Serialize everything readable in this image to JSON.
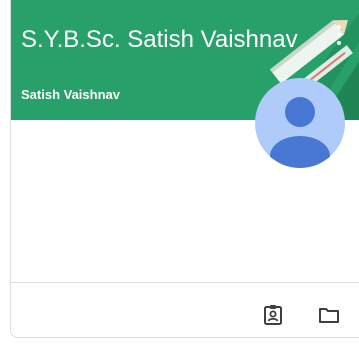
{
  "course_card": {
    "title": "S.Y.B.Sc. Satish Vaishnav",
    "teacher": "Satish Vaishnav",
    "banner_color": "#28a06a",
    "avatar_color": "#aecbfa",
    "avatar_figure_color": "#4778d4",
    "icons": {
      "menu": "more-vert-icon",
      "avatar": "person-icon",
      "work": "assignment-ind-icon",
      "folder": "folder-icon"
    }
  }
}
